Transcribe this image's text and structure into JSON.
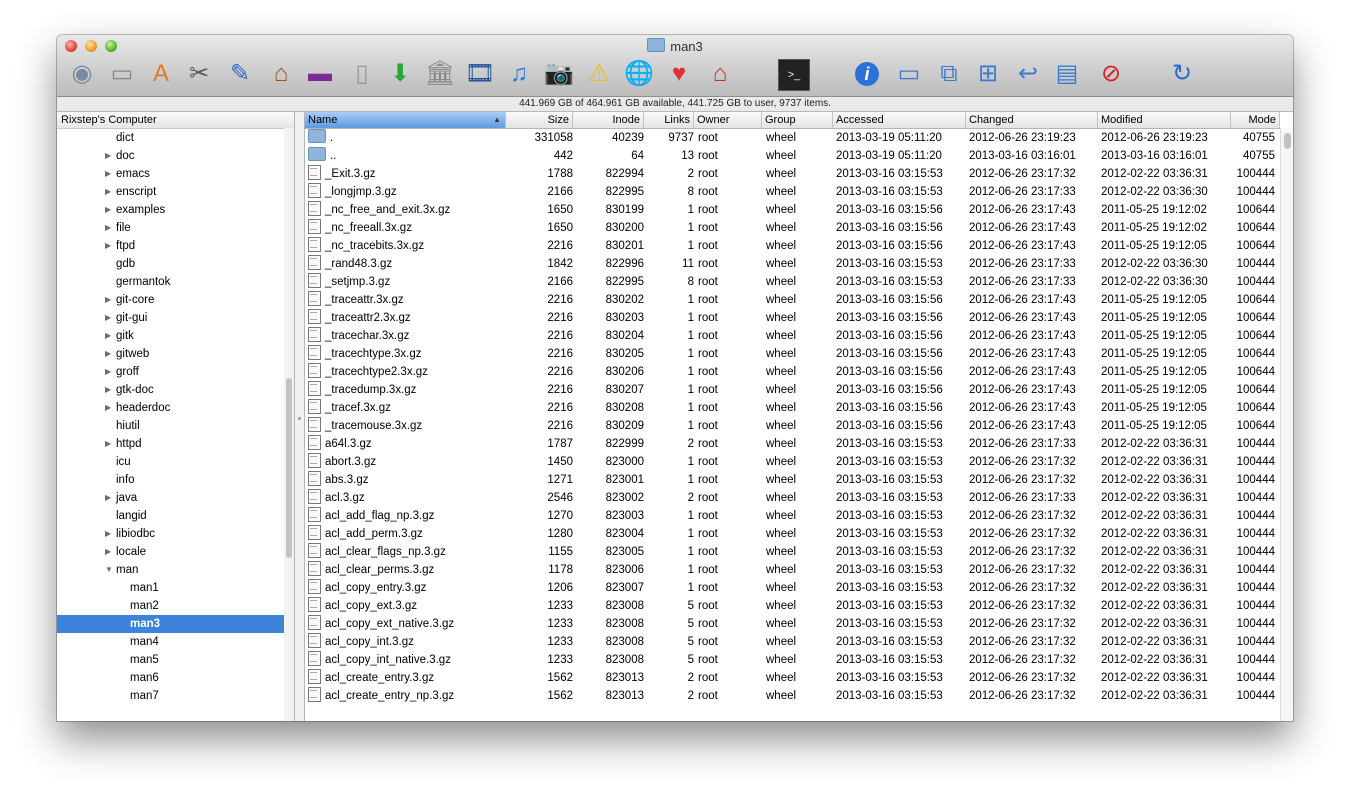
{
  "window": {
    "title": "man3",
    "status": "441.969 GB of 464.961 GB available, 441.725 GB to user, 9737 items."
  },
  "toolbar": {
    "icons": [
      {
        "name": "computer-icon",
        "glyph": "◉",
        "color": "#7a8aa0"
      },
      {
        "name": "harddisk-icon",
        "glyph": "▭",
        "color": "#888"
      },
      {
        "name": "applications-icon",
        "glyph": "A",
        "color": "#e07b24"
      },
      {
        "name": "utilities-icon",
        "glyph": "✂",
        "color": "#555"
      },
      {
        "name": "developer-icon",
        "glyph": "✎",
        "color": "#2b6cd0"
      },
      {
        "name": "home-icon",
        "glyph": "⌂",
        "color": "#a0522d"
      },
      {
        "name": "desktop-icon",
        "glyph": "▬",
        "color": "#7a2a9a"
      },
      {
        "name": "document-icon",
        "glyph": "▯",
        "color": "#999"
      },
      {
        "name": "downloads-icon",
        "glyph": "⬇",
        "color": "#2aa63c"
      },
      {
        "name": "library-icon",
        "glyph": "🏛",
        "color": "#888"
      },
      {
        "name": "movies-icon",
        "glyph": "🎞",
        "color": "#1a4f9a"
      },
      {
        "name": "music-icon",
        "glyph": "♫",
        "color": "#2a7ad8"
      },
      {
        "name": "pictures-icon",
        "glyph": "📷",
        "color": "#555"
      },
      {
        "name": "public-icon",
        "glyph": "⚠",
        "color": "#e6c21a"
      },
      {
        "name": "sites-icon",
        "glyph": "🌐",
        "color": "#2a6ad0"
      },
      {
        "name": "favorites-icon",
        "glyph": "♥",
        "color": "#e03030"
      },
      {
        "name": "home-folder-icon",
        "glyph": "⌂",
        "color": "#c03a2a"
      },
      {
        "name": "terminal-icon",
        "glyph": ">_",
        "color": "#111"
      },
      {
        "name": "info-icon",
        "glyph": "i",
        "color": "#1a6ad8"
      },
      {
        "name": "new-folder-icon",
        "glyph": "▭",
        "color": "#3a7ad0"
      },
      {
        "name": "duplicate-icon",
        "glyph": "⧉",
        "color": "#3a7ad0"
      },
      {
        "name": "new-file-icon",
        "glyph": "⊞",
        "color": "#3a7ad0"
      },
      {
        "name": "alias-icon",
        "glyph": "↩",
        "color": "#3a7ad0"
      },
      {
        "name": "archive-icon",
        "glyph": "▤",
        "color": "#3a7ad0"
      },
      {
        "name": "delete-icon",
        "glyph": "⊘",
        "color": "#d82020"
      },
      {
        "name": "refresh-icon",
        "glyph": "↻",
        "color": "#2a6ad0"
      }
    ]
  },
  "sidebar": {
    "header": "Rixstep's Computer",
    "items": [
      {
        "label": "dict",
        "disclosure": "",
        "level": 0
      },
      {
        "label": "doc",
        "disclosure": "▶",
        "level": 0
      },
      {
        "label": "emacs",
        "disclosure": "▶",
        "level": 0
      },
      {
        "label": "enscript",
        "disclosure": "▶",
        "level": 0
      },
      {
        "label": "examples",
        "disclosure": "▶",
        "level": 0
      },
      {
        "label": "file",
        "disclosure": "▶",
        "level": 0
      },
      {
        "label": "ftpd",
        "disclosure": "▶",
        "level": 0
      },
      {
        "label": "gdb",
        "disclosure": "",
        "level": 0
      },
      {
        "label": "germantok",
        "disclosure": "",
        "level": 0
      },
      {
        "label": "git-core",
        "disclosure": "▶",
        "level": 0
      },
      {
        "label": "git-gui",
        "disclosure": "▶",
        "level": 0
      },
      {
        "label": "gitk",
        "disclosure": "▶",
        "level": 0
      },
      {
        "label": "gitweb",
        "disclosure": "▶",
        "level": 0
      },
      {
        "label": "groff",
        "disclosure": "▶",
        "level": 0
      },
      {
        "label": "gtk-doc",
        "disclosure": "▶",
        "level": 0
      },
      {
        "label": "headerdoc",
        "disclosure": "▶",
        "level": 0
      },
      {
        "label": "hiutil",
        "disclosure": "",
        "level": 0
      },
      {
        "label": "httpd",
        "disclosure": "▶",
        "level": 0
      },
      {
        "label": "icu",
        "disclosure": "",
        "level": 0
      },
      {
        "label": "info",
        "disclosure": "",
        "level": 0
      },
      {
        "label": "java",
        "disclosure": "▶",
        "level": 0
      },
      {
        "label": "langid",
        "disclosure": "",
        "level": 0
      },
      {
        "label": "libiodbc",
        "disclosure": "▶",
        "level": 0
      },
      {
        "label": "locale",
        "disclosure": "▶",
        "level": 0
      },
      {
        "label": "man",
        "disclosure": "▼",
        "level": 0
      },
      {
        "label": "man1",
        "disclosure": "",
        "level": 1
      },
      {
        "label": "man2",
        "disclosure": "",
        "level": 1
      },
      {
        "label": "man3",
        "disclosure": "",
        "level": 1,
        "selected": true
      },
      {
        "label": "man4",
        "disclosure": "",
        "level": 1
      },
      {
        "label": "man5",
        "disclosure": "",
        "level": 1
      },
      {
        "label": "man6",
        "disclosure": "",
        "level": 1
      },
      {
        "label": "man7",
        "disclosure": "",
        "level": 1
      }
    ]
  },
  "table": {
    "columns": [
      "Name",
      "Size",
      "Inode",
      "Links",
      "Owner",
      "Group",
      "Accessed",
      "Changed",
      "Modified",
      "Mode"
    ],
    "rows": [
      {
        "type": "folder",
        "name": ".",
        "size": "331058",
        "inode": "40239",
        "links": "9737",
        "owner": "root",
        "group": "wheel",
        "accessed": "2013-03-19 05:11:20",
        "changed": "2012-06-26 23:19:23",
        "modified": "2012-06-26 23:19:23",
        "mode": "40755"
      },
      {
        "type": "folder",
        "name": "..",
        "size": "442",
        "inode": "64",
        "links": "13",
        "owner": "root",
        "group": "wheel",
        "accessed": "2013-03-19 05:11:20",
        "changed": "2013-03-16 03:16:01",
        "modified": "2013-03-16 03:16:01",
        "mode": "40755"
      },
      {
        "type": "file",
        "name": "_Exit.3.gz",
        "size": "1788",
        "inode": "822994",
        "links": "2",
        "owner": "root",
        "group": "wheel",
        "accessed": "2013-03-16 03:15:53",
        "changed": "2012-06-26 23:17:32",
        "modified": "2012-02-22 03:36:31",
        "mode": "100444"
      },
      {
        "type": "file",
        "name": "_longjmp.3.gz",
        "size": "2166",
        "inode": "822995",
        "links": "8",
        "owner": "root",
        "group": "wheel",
        "accessed": "2013-03-16 03:15:53",
        "changed": "2012-06-26 23:17:33",
        "modified": "2012-02-22 03:36:30",
        "mode": "100444"
      },
      {
        "type": "file",
        "name": "_nc_free_and_exit.3x.gz",
        "size": "1650",
        "inode": "830199",
        "links": "1",
        "owner": "root",
        "group": "wheel",
        "accessed": "2013-03-16 03:15:56",
        "changed": "2012-06-26 23:17:43",
        "modified": "2011-05-25 19:12:02",
        "mode": "100644"
      },
      {
        "type": "file",
        "name": "_nc_freeall.3x.gz",
        "size": "1650",
        "inode": "830200",
        "links": "1",
        "owner": "root",
        "group": "wheel",
        "accessed": "2013-03-16 03:15:56",
        "changed": "2012-06-26 23:17:43",
        "modified": "2011-05-25 19:12:02",
        "mode": "100644"
      },
      {
        "type": "file",
        "name": "_nc_tracebits.3x.gz",
        "size": "2216",
        "inode": "830201",
        "links": "1",
        "owner": "root",
        "group": "wheel",
        "accessed": "2013-03-16 03:15:56",
        "changed": "2012-06-26 23:17:43",
        "modified": "2011-05-25 19:12:05",
        "mode": "100644"
      },
      {
        "type": "file",
        "name": "_rand48.3.gz",
        "size": "1842",
        "inode": "822996",
        "links": "11",
        "owner": "root",
        "group": "wheel",
        "accessed": "2013-03-16 03:15:53",
        "changed": "2012-06-26 23:17:33",
        "modified": "2012-02-22 03:36:30",
        "mode": "100444"
      },
      {
        "type": "file",
        "name": "_setjmp.3.gz",
        "size": "2166",
        "inode": "822995",
        "links": "8",
        "owner": "root",
        "group": "wheel",
        "accessed": "2013-03-16 03:15:53",
        "changed": "2012-06-26 23:17:33",
        "modified": "2012-02-22 03:36:30",
        "mode": "100444"
      },
      {
        "type": "file",
        "name": "_traceattr.3x.gz",
        "size": "2216",
        "inode": "830202",
        "links": "1",
        "owner": "root",
        "group": "wheel",
        "accessed": "2013-03-16 03:15:56",
        "changed": "2012-06-26 23:17:43",
        "modified": "2011-05-25 19:12:05",
        "mode": "100644"
      },
      {
        "type": "file",
        "name": "_traceattr2.3x.gz",
        "size": "2216",
        "inode": "830203",
        "links": "1",
        "owner": "root",
        "group": "wheel",
        "accessed": "2013-03-16 03:15:56",
        "changed": "2012-06-26 23:17:43",
        "modified": "2011-05-25 19:12:05",
        "mode": "100644"
      },
      {
        "type": "file",
        "name": "_tracechar.3x.gz",
        "size": "2216",
        "inode": "830204",
        "links": "1",
        "owner": "root",
        "group": "wheel",
        "accessed": "2013-03-16 03:15:56",
        "changed": "2012-06-26 23:17:43",
        "modified": "2011-05-25 19:12:05",
        "mode": "100644"
      },
      {
        "type": "file",
        "name": "_tracechtype.3x.gz",
        "size": "2216",
        "inode": "830205",
        "links": "1",
        "owner": "root",
        "group": "wheel",
        "accessed": "2013-03-16 03:15:56",
        "changed": "2012-06-26 23:17:43",
        "modified": "2011-05-25 19:12:05",
        "mode": "100644"
      },
      {
        "type": "file",
        "name": "_tracechtype2.3x.gz",
        "size": "2216",
        "inode": "830206",
        "links": "1",
        "owner": "root",
        "group": "wheel",
        "accessed": "2013-03-16 03:15:56",
        "changed": "2012-06-26 23:17:43",
        "modified": "2011-05-25 19:12:05",
        "mode": "100644"
      },
      {
        "type": "file",
        "name": "_tracedump.3x.gz",
        "size": "2216",
        "inode": "830207",
        "links": "1",
        "owner": "root",
        "group": "wheel",
        "accessed": "2013-03-16 03:15:56",
        "changed": "2012-06-26 23:17:43",
        "modified": "2011-05-25 19:12:05",
        "mode": "100644"
      },
      {
        "type": "file",
        "name": "_tracef.3x.gz",
        "size": "2216",
        "inode": "830208",
        "links": "1",
        "owner": "root",
        "group": "wheel",
        "accessed": "2013-03-16 03:15:56",
        "changed": "2012-06-26 23:17:43",
        "modified": "2011-05-25 19:12:05",
        "mode": "100644"
      },
      {
        "type": "file",
        "name": "_tracemouse.3x.gz",
        "size": "2216",
        "inode": "830209",
        "links": "1",
        "owner": "root",
        "group": "wheel",
        "accessed": "2013-03-16 03:15:56",
        "changed": "2012-06-26 23:17:43",
        "modified": "2011-05-25 19:12:05",
        "mode": "100644"
      },
      {
        "type": "file",
        "name": "a64l.3.gz",
        "size": "1787",
        "inode": "822999",
        "links": "2",
        "owner": "root",
        "group": "wheel",
        "accessed": "2013-03-16 03:15:53",
        "changed": "2012-06-26 23:17:33",
        "modified": "2012-02-22 03:36:31",
        "mode": "100444"
      },
      {
        "type": "file",
        "name": "abort.3.gz",
        "size": "1450",
        "inode": "823000",
        "links": "1",
        "owner": "root",
        "group": "wheel",
        "accessed": "2013-03-16 03:15:53",
        "changed": "2012-06-26 23:17:32",
        "modified": "2012-02-22 03:36:31",
        "mode": "100444"
      },
      {
        "type": "file",
        "name": "abs.3.gz",
        "size": "1271",
        "inode": "823001",
        "links": "1",
        "owner": "root",
        "group": "wheel",
        "accessed": "2013-03-16 03:15:53",
        "changed": "2012-06-26 23:17:32",
        "modified": "2012-02-22 03:36:31",
        "mode": "100444"
      },
      {
        "type": "file",
        "name": "acl.3.gz",
        "size": "2546",
        "inode": "823002",
        "links": "2",
        "owner": "root",
        "group": "wheel",
        "accessed": "2013-03-16 03:15:53",
        "changed": "2012-06-26 23:17:33",
        "modified": "2012-02-22 03:36:31",
        "mode": "100444"
      },
      {
        "type": "file",
        "name": "acl_add_flag_np.3.gz",
        "size": "1270",
        "inode": "823003",
        "links": "1",
        "owner": "root",
        "group": "wheel",
        "accessed": "2013-03-16 03:15:53",
        "changed": "2012-06-26 23:17:32",
        "modified": "2012-02-22 03:36:31",
        "mode": "100444"
      },
      {
        "type": "file",
        "name": "acl_add_perm.3.gz",
        "size": "1280",
        "inode": "823004",
        "links": "1",
        "owner": "root",
        "group": "wheel",
        "accessed": "2013-03-16 03:15:53",
        "changed": "2012-06-26 23:17:32",
        "modified": "2012-02-22 03:36:31",
        "mode": "100444"
      },
      {
        "type": "file",
        "name": "acl_clear_flags_np.3.gz",
        "size": "1155",
        "inode": "823005",
        "links": "1",
        "owner": "root",
        "group": "wheel",
        "accessed": "2013-03-16 03:15:53",
        "changed": "2012-06-26 23:17:32",
        "modified": "2012-02-22 03:36:31",
        "mode": "100444"
      },
      {
        "type": "file",
        "name": "acl_clear_perms.3.gz",
        "size": "1178",
        "inode": "823006",
        "links": "1",
        "owner": "root",
        "group": "wheel",
        "accessed": "2013-03-16 03:15:53",
        "changed": "2012-06-26 23:17:32",
        "modified": "2012-02-22 03:36:31",
        "mode": "100444"
      },
      {
        "type": "file",
        "name": "acl_copy_entry.3.gz",
        "size": "1206",
        "inode": "823007",
        "links": "1",
        "owner": "root",
        "group": "wheel",
        "accessed": "2013-03-16 03:15:53",
        "changed": "2012-06-26 23:17:32",
        "modified": "2012-02-22 03:36:31",
        "mode": "100444"
      },
      {
        "type": "file",
        "name": "acl_copy_ext.3.gz",
        "size": "1233",
        "inode": "823008",
        "links": "5",
        "owner": "root",
        "group": "wheel",
        "accessed": "2013-03-16 03:15:53",
        "changed": "2012-06-26 23:17:32",
        "modified": "2012-02-22 03:36:31",
        "mode": "100444"
      },
      {
        "type": "file",
        "name": "acl_copy_ext_native.3.gz",
        "size": "1233",
        "inode": "823008",
        "links": "5",
        "owner": "root",
        "group": "wheel",
        "accessed": "2013-03-16 03:15:53",
        "changed": "2012-06-26 23:17:32",
        "modified": "2012-02-22 03:36:31",
        "mode": "100444"
      },
      {
        "type": "file",
        "name": "acl_copy_int.3.gz",
        "size": "1233",
        "inode": "823008",
        "links": "5",
        "owner": "root",
        "group": "wheel",
        "accessed": "2013-03-16 03:15:53",
        "changed": "2012-06-26 23:17:32",
        "modified": "2012-02-22 03:36:31",
        "mode": "100444"
      },
      {
        "type": "file",
        "name": "acl_copy_int_native.3.gz",
        "size": "1233",
        "inode": "823008",
        "links": "5",
        "owner": "root",
        "group": "wheel",
        "accessed": "2013-03-16 03:15:53",
        "changed": "2012-06-26 23:17:32",
        "modified": "2012-02-22 03:36:31",
        "mode": "100444"
      },
      {
        "type": "file",
        "name": "acl_create_entry.3.gz",
        "size": "1562",
        "inode": "823013",
        "links": "2",
        "owner": "root",
        "group": "wheel",
        "accessed": "2013-03-16 03:15:53",
        "changed": "2012-06-26 23:17:32",
        "modified": "2012-02-22 03:36:31",
        "mode": "100444"
      },
      {
        "type": "file",
        "name": "acl_create_entry_np.3.gz",
        "size": "1562",
        "inode": "823013",
        "links": "2",
        "owner": "root",
        "group": "wheel",
        "accessed": "2013-03-16 03:15:53",
        "changed": "2012-06-26 23:17:32",
        "modified": "2012-02-22 03:36:31",
        "mode": "100444"
      }
    ]
  }
}
